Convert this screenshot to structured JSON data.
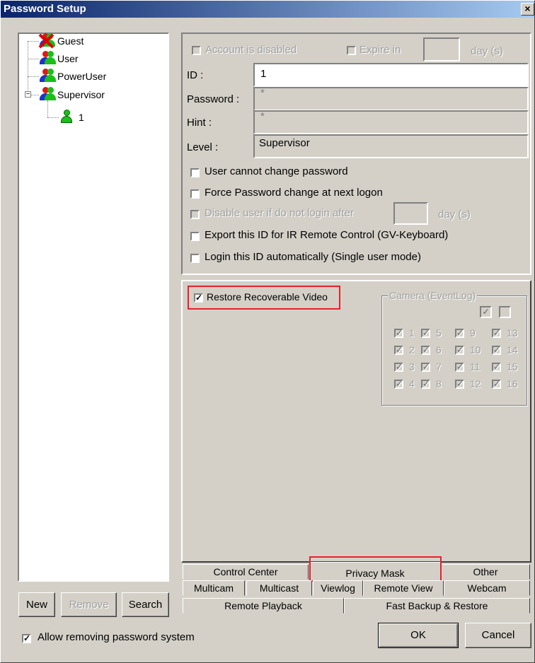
{
  "window": {
    "title": "Password Setup",
    "close_label": "×"
  },
  "tree": {
    "items": [
      {
        "label": "Guest",
        "icon": "guest-disabled-user-icon"
      },
      {
        "label": "User",
        "icon": "user-group-icon"
      },
      {
        "label": "PowerUser",
        "icon": "user-group-icon"
      },
      {
        "label": "Supervisor",
        "icon": "user-group-icon",
        "expander": "−"
      },
      {
        "label": "1",
        "icon": "user-icon"
      }
    ]
  },
  "account": {
    "disabled_label": "Account is disabled",
    "expire_label": "Expire in",
    "expire_unit": "day (s)",
    "id_label": "ID :",
    "id_value": "1",
    "password_label": "Password :",
    "password_value": "*",
    "hint_label": "Hint :",
    "hint_value": "*",
    "level_label": "Level :",
    "level_value": "Supervisor",
    "options": [
      {
        "label": "User cannot change password",
        "checked": false,
        "enabled": true
      },
      {
        "label": "Force Password change at next logon",
        "checked": false,
        "enabled": true
      },
      {
        "label": "Disable user if do not login after",
        "checked": false,
        "enabled": false,
        "unit": "day (s)"
      },
      {
        "label": "Export this ID for IR Remote Control (GV-Keyboard)",
        "checked": false,
        "enabled": true
      },
      {
        "label": "Login this ID automatically (Single user mode)",
        "checked": false,
        "enabled": true
      }
    ]
  },
  "restore": {
    "label": "Restore Recoverable Video",
    "checked": true,
    "camera_group_title": "Camera (EventLog)",
    "cameras": [
      "1",
      "2",
      "3",
      "4",
      "5",
      "6",
      "7",
      "8",
      "9",
      "10",
      "11",
      "12",
      "13",
      "14",
      "15",
      "16"
    ]
  },
  "tabs": {
    "row1": [
      "Control Center",
      "Privacy Mask",
      "Other"
    ],
    "row2": [
      "Multicam",
      "Multicast",
      "Viewlog",
      "Remote View",
      "Webcam"
    ],
    "row3": [
      "Remote Playback",
      "Fast Backup & Restore"
    ]
  },
  "buttons": {
    "new": "New",
    "remove": "Remove",
    "search": "Search",
    "ok": "OK",
    "cancel": "Cancel"
  },
  "footer": {
    "allow_removing_label": "Allow removing password system",
    "allow_removing_checked": true
  },
  "colors": {
    "highlight_box": "#e8202a",
    "title_bar": "#0a246a",
    "face": "#d4d0c8"
  }
}
